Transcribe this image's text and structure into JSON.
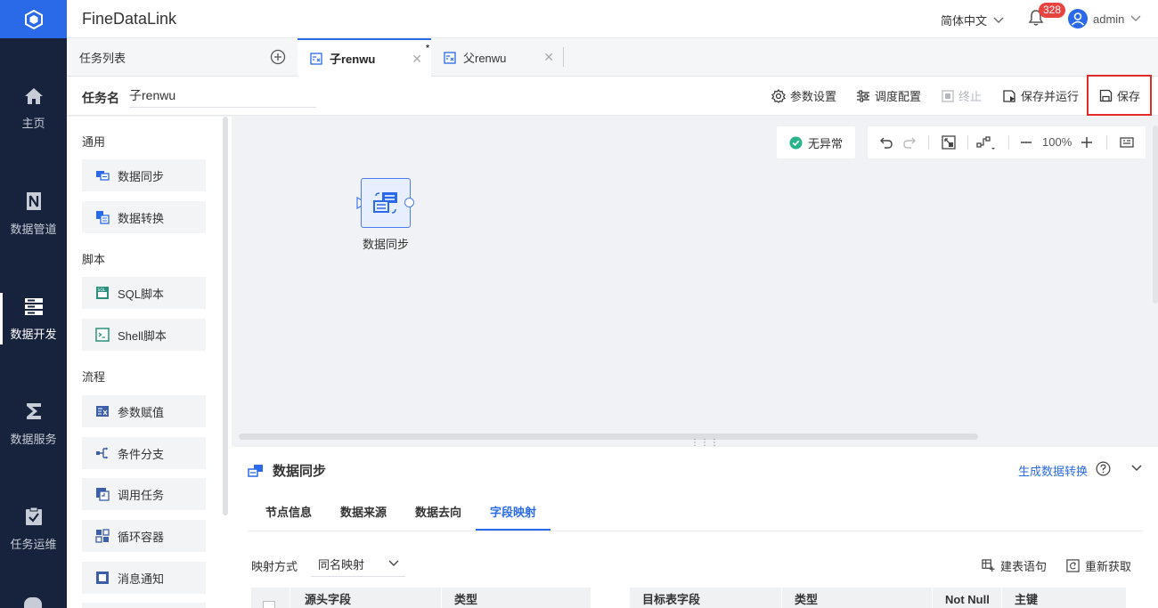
{
  "app": {
    "title": "FineDataLink"
  },
  "header": {
    "language": "简体中文",
    "notification_count": "328",
    "username": "admin"
  },
  "nav": [
    {
      "label": "主页",
      "icon": "home-icon"
    },
    {
      "label": "数据管道",
      "icon": "pipeline-icon"
    },
    {
      "label": "数据开发",
      "icon": "dev-icon",
      "active": true
    },
    {
      "label": "数据服务",
      "icon": "service-icon"
    },
    {
      "label": "任务运维",
      "icon": "ops-icon"
    }
  ],
  "tabs": {
    "task_list": "任务列表",
    "items": [
      {
        "label": "子renwu",
        "active": true,
        "dirty": "*"
      },
      {
        "label": "父renwu",
        "active": false
      }
    ]
  },
  "task": {
    "name_label": "任务名",
    "name_value": "子renwu",
    "actions": {
      "params": "参数设置",
      "schedule": "调度配置",
      "stop": "终止",
      "save_run": "保存并运行",
      "save": "保存"
    }
  },
  "palette": {
    "groups": [
      {
        "title": "通用",
        "items": [
          "数据同步",
          "数据转换"
        ]
      },
      {
        "title": "脚本",
        "items": [
          "SQL脚本",
          "Shell脚本"
        ]
      },
      {
        "title": "流程",
        "items": [
          "参数赋值",
          "条件分支",
          "调用任务",
          "循环容器",
          "消息通知"
        ]
      }
    ]
  },
  "canvas": {
    "status": "无异常",
    "zoom": "100%",
    "node_label": "数据同步"
  },
  "panel": {
    "title": "数据同步",
    "generate_link": "生成数据转换",
    "subtabs": [
      "节点信息",
      "数据来源",
      "数据去向",
      "字段映射"
    ],
    "active_subtab": "字段映射",
    "mapping_label": "映射方式",
    "mapping_value": "同名映射",
    "build_sql": "建表语句",
    "refetch": "重新获取",
    "source_columns": [
      "源头字段",
      "类型"
    ],
    "target_columns": [
      "目标表字段",
      "类型",
      "Not Null",
      "主键"
    ]
  },
  "colors": {
    "accent": "#2a6ae9",
    "nav_bg": "#17233d",
    "highlight": "#e32b2b"
  }
}
